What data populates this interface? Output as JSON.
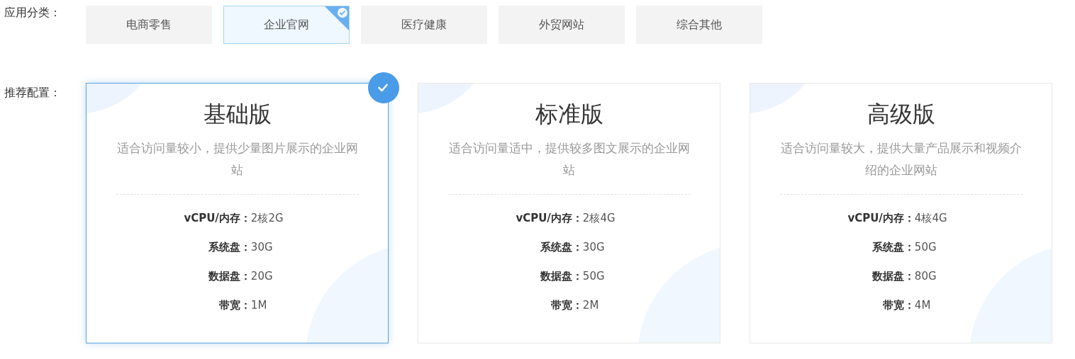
{
  "category": {
    "label": "应用分类：",
    "options": [
      {
        "label": "电商零售",
        "selected": false
      },
      {
        "label": "企业官网",
        "selected": true
      },
      {
        "label": "医疗健康",
        "selected": false
      },
      {
        "label": "外贸网站",
        "selected": false
      },
      {
        "label": "综合其他",
        "selected": false
      }
    ]
  },
  "plans": {
    "label": "推荐配置：",
    "items": [
      {
        "title": "基础版",
        "description": "适合访问量较小，提供少量图片展示的企业网站",
        "selected": true,
        "specs": [
          {
            "label": "vCPU/内存：",
            "value": "2核2G"
          },
          {
            "label": "系统盘：",
            "value": "30G"
          },
          {
            "label": "数据盘：",
            "value": "20G"
          },
          {
            "label": "带宽：",
            "value": "1M"
          }
        ]
      },
      {
        "title": "标准版",
        "description": "适合访问量适中，提供较多图文展示的企业网站",
        "selected": false,
        "specs": [
          {
            "label": "vCPU/内存：",
            "value": "2核4G"
          },
          {
            "label": "系统盘：",
            "value": "30G"
          },
          {
            "label": "数据盘：",
            "value": "50G"
          },
          {
            "label": "带宽：",
            "value": "2M"
          }
        ]
      },
      {
        "title": "高级版",
        "description": "适合访问量较大，提供大量产品展示和视频介绍的企业网站",
        "selected": false,
        "specs": [
          {
            "label": "vCPU/内存：",
            "value": "4核4G"
          },
          {
            "label": "系统盘：",
            "value": "50G"
          },
          {
            "label": "数据盘：",
            "value": "80G"
          },
          {
            "label": "带宽：",
            "value": "4M"
          }
        ]
      }
    ]
  }
}
